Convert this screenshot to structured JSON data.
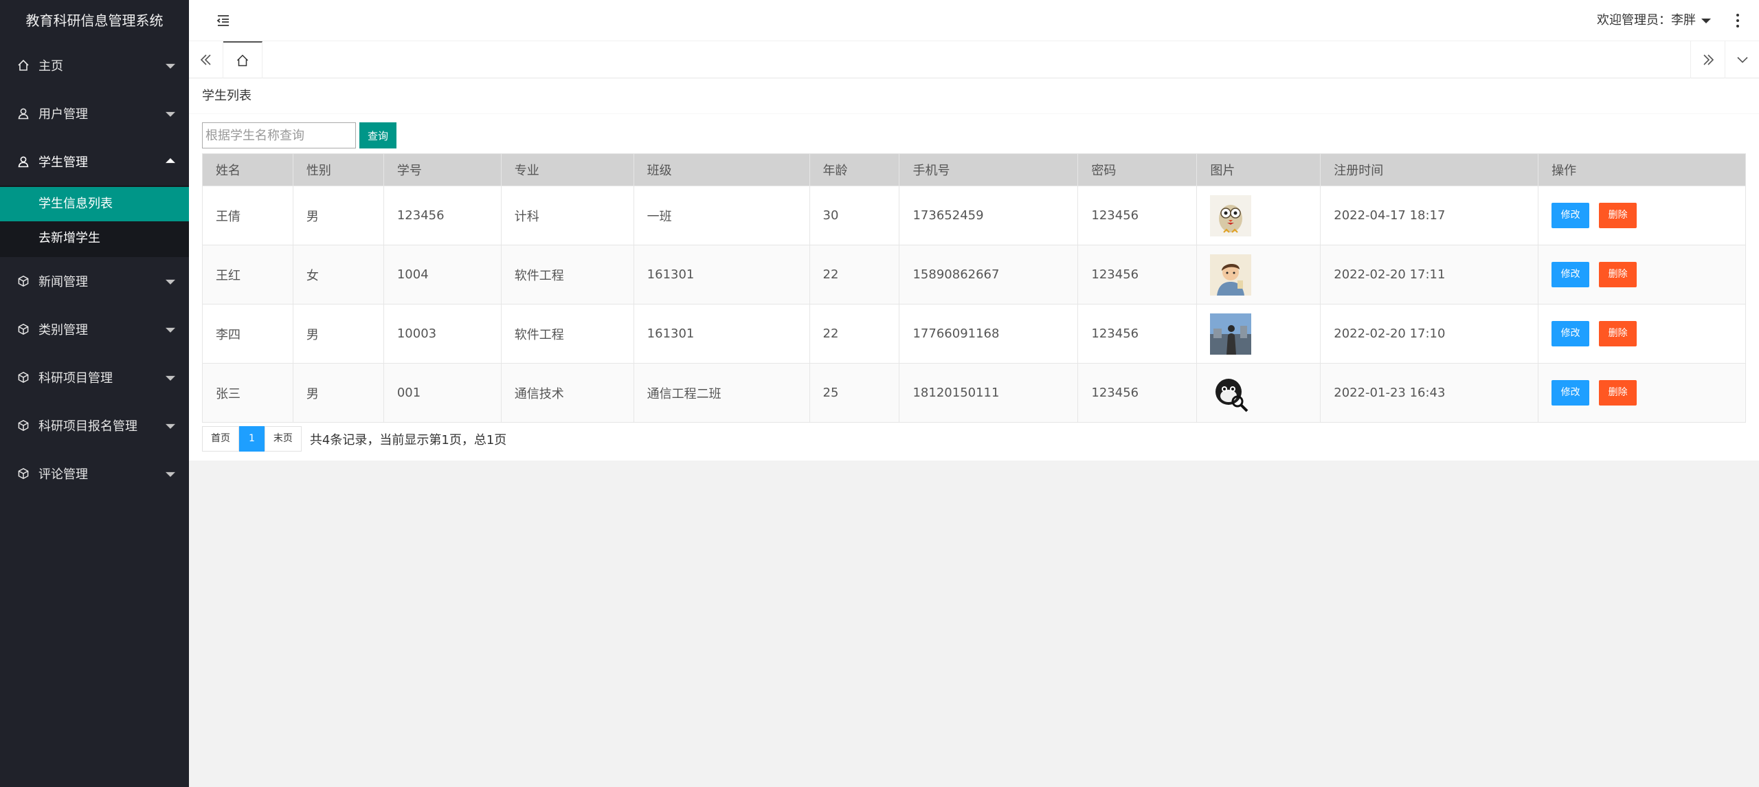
{
  "app": {
    "title": "教育科研信息管理系统"
  },
  "sidebar": {
    "items": [
      {
        "label": "主页",
        "icon": "home-icon"
      },
      {
        "label": "用户管理",
        "icon": "user-icon"
      },
      {
        "label": "学生管理",
        "icon": "user-icon",
        "open": true,
        "children": [
          {
            "label": "学生信息列表",
            "active": true
          },
          {
            "label": "去新增学生"
          }
        ]
      },
      {
        "label": "新闻管理",
        "icon": "cube-icon"
      },
      {
        "label": "类别管理",
        "icon": "cube-icon"
      },
      {
        "label": "科研项目管理",
        "icon": "cube-icon"
      },
      {
        "label": "科研项目报名管理",
        "icon": "cube-icon"
      },
      {
        "label": "评论管理",
        "icon": "cube-icon"
      }
    ]
  },
  "header": {
    "welcome": "欢迎管理员：李胖"
  },
  "page": {
    "title": "学生列表"
  },
  "search": {
    "placeholder": "根据学生名称查询",
    "button": "查询"
  },
  "table": {
    "headers": [
      "姓名",
      "性别",
      "学号",
      "专业",
      "班级",
      "年龄",
      "手机号",
      "密码",
      "图片",
      "注册时间",
      "操作"
    ],
    "rows": [
      {
        "name": "王倩",
        "gender": "男",
        "id": "123456",
        "major": "计科",
        "class": "一班",
        "age": "30",
        "phone": "173652459",
        "password": "123456",
        "image": "owl-avatar",
        "registered": "2022-04-17 18:17"
      },
      {
        "name": "王红",
        "gender": "女",
        "id": "1004",
        "major": "软件工程",
        "class": "161301",
        "age": "22",
        "phone": "15890862667",
        "password": "123456",
        "image": "boy-avatar",
        "registered": "2022-02-20 17:11"
      },
      {
        "name": "李四",
        "gender": "男",
        "id": "10003",
        "major": "软件工程",
        "class": "161301",
        "age": "22",
        "phone": "17766091168",
        "password": "123456",
        "image": "photo-avatar",
        "registered": "2022-02-20 17:10"
      },
      {
        "name": "张三",
        "gender": "男",
        "id": "001",
        "major": "通信技术",
        "class": "通信工程二班",
        "age": "25",
        "phone": "18120150111",
        "password": "123456",
        "image": "monkey-avatar",
        "registered": "2022-01-23 16:43"
      }
    ],
    "edit_label": "修改",
    "delete_label": "删除"
  },
  "pager": {
    "first": "首页",
    "current": "1",
    "last": "末页",
    "info": "共4条记录，当前显示第1页，总1页"
  },
  "colors": {
    "sidebar": "#20222a",
    "active": "#009688",
    "edit": "#1e9fff",
    "delete": "#ff5722"
  }
}
